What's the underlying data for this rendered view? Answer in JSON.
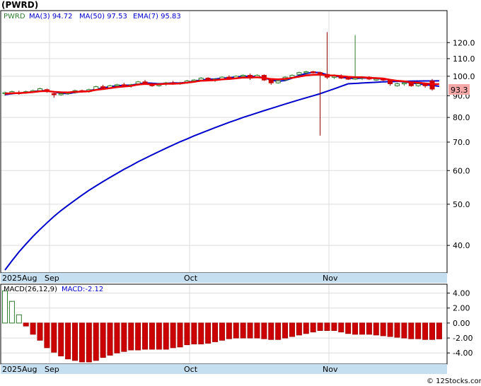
{
  "title": "(PWRD)",
  "credit": "© 12Stocks.com",
  "colors": {
    "up": "#2e7d2e",
    "down": "#cc0000",
    "ma": "#0000cc",
    "ema": "#ee0000",
    "axisband": "#c5dff0",
    "lastbox": "#f4a8a8"
  },
  "price_legend": {
    "symbol": "PWRD",
    "ma3": "MA(3) 94.72",
    "ma50": "MA(50) 97.53",
    "ema7": "EMA(7) 95.83"
  },
  "last_price": "93.3",
  "macd_legend": {
    "name": "MACD(26,12,9)",
    "value": "MACD:-2.12"
  },
  "x_labels": [
    "2025Aug",
    "Sep",
    "Oct",
    "Nov"
  ],
  "chart_data": [
    {
      "type": "candlestick",
      "scale": "log",
      "ylim": [
        35,
        140
      ],
      "yticks": [
        "120.0",
        "110.0",
        "100.0",
        "90.0",
        "80.0",
        "70.0",
        "60.0",
        "50.0",
        "40.0"
      ],
      "ytick_values": [
        120,
        110,
        100,
        90,
        80,
        70,
        60,
        50,
        40
      ],
      "candles": [
        {
          "o": 91,
          "h": 92,
          "l": 90,
          "c": 91.5
        },
        {
          "o": 91,
          "h": 92.5,
          "l": 90.5,
          "c": 92
        },
        {
          "o": 91.5,
          "h": 92.5,
          "l": 90.5,
          "c": 91
        },
        {
          "o": 91.5,
          "h": 92.5,
          "l": 91,
          "c": 92
        },
        {
          "o": 92,
          "h": 93,
          "l": 91.5,
          "c": 92.5
        },
        {
          "o": 92.5,
          "h": 94,
          "l": 92,
          "c": 93.5
        },
        {
          "o": 93,
          "h": 93.5,
          "l": 91.5,
          "c": 92
        },
        {
          "o": 91,
          "h": 91.5,
          "l": 89,
          "c": 90.5
        },
        {
          "o": 90.5,
          "h": 91.5,
          "l": 90,
          "c": 91
        },
        {
          "o": 91,
          "h": 92,
          "l": 90.5,
          "c": 91.5
        },
        {
          "o": 91.5,
          "h": 93,
          "l": 91,
          "c": 92.5
        },
        {
          "o": 92.5,
          "h": 93,
          "l": 91.5,
          "c": 92
        },
        {
          "o": 92,
          "h": 93.5,
          "l": 91.5,
          "c": 93
        },
        {
          "o": 93,
          "h": 95,
          "l": 92.5,
          "c": 94.5
        },
        {
          "o": 94.5,
          "h": 95.5,
          "l": 93.5,
          "c": 94
        },
        {
          "o": 94,
          "h": 95.5,
          "l": 93.5,
          "c": 95
        },
        {
          "o": 95,
          "h": 96,
          "l": 94,
          "c": 95.5
        },
        {
          "o": 95.5,
          "h": 96.5,
          "l": 94.5,
          "c": 95
        },
        {
          "o": 95,
          "h": 96,
          "l": 94,
          "c": 95.5
        },
        {
          "o": 96,
          "h": 97.5,
          "l": 95,
          "c": 97
        },
        {
          "o": 97,
          "h": 98,
          "l": 96,
          "c": 96.5
        },
        {
          "o": 96,
          "h": 96.5,
          "l": 94.5,
          "c": 95
        },
        {
          "o": 95,
          "h": 96.5,
          "l": 94.5,
          "c": 96
        },
        {
          "o": 96,
          "h": 97,
          "l": 95,
          "c": 96.5
        },
        {
          "o": 96.5,
          "h": 97.5,
          "l": 95.5,
          "c": 96
        },
        {
          "o": 96,
          "h": 97,
          "l": 95.5,
          "c": 96.5
        },
        {
          "o": 96.5,
          "h": 98,
          "l": 96,
          "c": 97.5
        },
        {
          "o": 97.5,
          "h": 98.5,
          "l": 97,
          "c": 98
        },
        {
          "o": 98,
          "h": 99.5,
          "l": 97.5,
          "c": 99
        },
        {
          "o": 99,
          "h": 99.5,
          "l": 97.5,
          "c": 98
        },
        {
          "o": 98,
          "h": 99,
          "l": 97,
          "c": 98.5
        },
        {
          "o": 98.5,
          "h": 100,
          "l": 98,
          "c": 99.5
        },
        {
          "o": 99.5,
          "h": 100.5,
          "l": 98.5,
          "c": 99
        },
        {
          "o": 99,
          "h": 100.5,
          "l": 98.5,
          "c": 100
        },
        {
          "o": 100,
          "h": 101,
          "l": 99,
          "c": 100.5
        },
        {
          "o": 100.5,
          "h": 101.5,
          "l": 98,
          "c": 99
        },
        {
          "o": 99.5,
          "h": 101,
          "l": 99,
          "c": 100.5
        },
        {
          "o": 100.5,
          "h": 101,
          "l": 97.5,
          "c": 98
        },
        {
          "o": 98,
          "h": 98.5,
          "l": 95.5,
          "c": 96.5
        },
        {
          "o": 96.5,
          "h": 98,
          "l": 96,
          "c": 97.5
        },
        {
          "o": 98,
          "h": 100,
          "l": 97.5,
          "c": 99.5
        },
        {
          "o": 99.5,
          "h": 101,
          "l": 99,
          "c": 100.5
        },
        {
          "o": 101,
          "h": 102.5,
          "l": 100.5,
          "c": 102
        },
        {
          "o": 102,
          "h": 103,
          "l": 101,
          "c": 102.5
        },
        {
          "o": 102.5,
          "h": 103,
          "l": 101.5,
          "c": 102
        },
        {
          "o": 102,
          "h": 102.5,
          "l": 72.5,
          "c": 101
        },
        {
          "o": 101,
          "h": 127,
          "l": 98.5,
          "c": 99.5
        },
        {
          "o": 99.5,
          "h": 101,
          "l": 98.5,
          "c": 100
        },
        {
          "o": 100,
          "h": 101,
          "l": 98.5,
          "c": 99
        },
        {
          "o": 99,
          "h": 100,
          "l": 98,
          "c": 98.5
        },
        {
          "o": 98.5,
          "h": 125,
          "l": 98,
          "c": 99
        },
        {
          "o": 99,
          "h": 100,
          "l": 98,
          "c": 99.5
        },
        {
          "o": 99.5,
          "h": 100,
          "l": 98,
          "c": 98.5
        },
        {
          "o": 98.5,
          "h": 99.5,
          "l": 97.5,
          "c": 98.5
        },
        {
          "o": 98.5,
          "h": 99,
          "l": 97.5,
          "c": 98
        },
        {
          "o": 98,
          "h": 98.5,
          "l": 95,
          "c": 96
        },
        {
          "o": 95,
          "h": 96.5,
          "l": 94.5,
          "c": 96
        },
        {
          "o": 96,
          "h": 97,
          "l": 95,
          "c": 96.5
        },
        {
          "o": 96.5,
          "h": 97,
          "l": 94.5,
          "c": 95
        },
        {
          "o": 95,
          "h": 96.5,
          "l": 94.5,
          "c": 96
        },
        {
          "o": 96,
          "h": 96.5,
          "l": 94,
          "c": 95
        },
        {
          "o": 97.5,
          "h": 98.5,
          "l": 92.5,
          "c": 93.3
        }
      ],
      "ma3": [
        90.5,
        91,
        91.3,
        91.5,
        92,
        92.5,
        92.5,
        91.8,
        91.2,
        91,
        91.6,
        92,
        92.5,
        93.2,
        93.9,
        94.5,
        95,
        95.2,
        95.3,
        95.9,
        96.5,
        96.3,
        96,
        96.2,
        96.5,
        96.4,
        96.8,
        97.4,
        98,
        98.3,
        98.5,
        98.9,
        99.2,
        99.6,
        100,
        100,
        99.8,
        99.2,
        97.9,
        97.3,
        97.7,
        99,
        100.5,
        101.5,
        102.2,
        102,
        100.8,
        100.2,
        99.5,
        99,
        98.8,
        99,
        99.1,
        98.8,
        98.5,
        98,
        97.5,
        97,
        96.5,
        96,
        95.5,
        95.2,
        94.7
      ],
      "ma50": [
        35,
        36.8,
        38.6,
        40.3,
        42,
        43.6,
        45.2,
        46.8,
        48.3,
        49.7,
        51.1,
        52.5,
        53.9,
        55.2,
        56.5,
        57.8,
        59.1,
        60.4,
        61.6,
        62.9,
        64.1,
        65.3,
        66.5,
        67.7,
        68.9,
        70.1,
        71.2,
        72.4,
        73.5,
        74.6,
        75.7,
        76.8,
        77.9,
        78.9,
        80,
        81,
        82,
        83,
        84,
        85,
        86,
        87,
        88,
        89,
        90,
        91,
        92.2,
        93.4,
        94.7,
        96,
        96.2,
        96.4,
        96.6,
        96.8,
        97,
        97.1,
        97.2,
        97.3,
        97.4,
        97.45,
        97.5,
        97.5,
        97.53
      ],
      "ema7": [
        91,
        91.2,
        91.3,
        91.5,
        91.8,
        92.2,
        92.3,
        91.9,
        91.7,
        91.6,
        91.9,
        92,
        92.2,
        92.9,
        93.3,
        93.8,
        94.3,
        94.6,
        94.9,
        95.6,
        95.9,
        95.7,
        95.8,
        96,
        96,
        96.2,
        96.6,
        97,
        97.6,
        97.7,
        97.9,
        98.3,
        98.5,
        98.9,
        99.3,
        99.3,
        99.5,
        99.1,
        98.5,
        98.3,
        98.6,
        99.1,
        99.8,
        100.5,
        100.8,
        100.9,
        100.5,
        100.4,
        100.1,
        99.7,
        99.5,
        99.5,
        99.2,
        99,
        98.8,
        98.1,
        97.6,
        97.3,
        96.8,
        96.6,
        96.2,
        95.83,
        95.83
      ]
    },
    {
      "type": "bar",
      "ylim": [
        -5.3,
        5.0
      ],
      "yticks": [
        "4.00",
        "2.00",
        "0.00",
        "-2.00",
        "-4.00"
      ],
      "ytick_values": [
        4,
        2,
        0,
        -2,
        -4
      ],
      "values": [
        4.3,
        2.9,
        1.1,
        -0.4,
        -1.5,
        -2.3,
        -3.3,
        -3.9,
        -4.4,
        -4.8,
        -5.0,
        -5.2,
        -5.2,
        -5.0,
        -4.6,
        -4.3,
        -4.0,
        -3.8,
        -3.6,
        -3.6,
        -3.5,
        -3.5,
        -3.5,
        -3.5,
        -3.3,
        -3.2,
        -2.9,
        -2.8,
        -2.8,
        -2.7,
        -2.5,
        -2.3,
        -2.1,
        -2.0,
        -2.0,
        -2.0,
        -2.0,
        -2.1,
        -2.2,
        -2.2,
        -2.0,
        -1.8,
        -1.6,
        -1.4,
        -1.2,
        -1.0,
        -1.0,
        -1.0,
        -1.2,
        -1.4,
        -1.5,
        -1.5,
        -1.5,
        -1.6,
        -1.7,
        -1.8,
        -1.9,
        -2.0,
        -2.1,
        -2.1,
        -2.2,
        -2.2,
        -2.12
      ]
    }
  ]
}
